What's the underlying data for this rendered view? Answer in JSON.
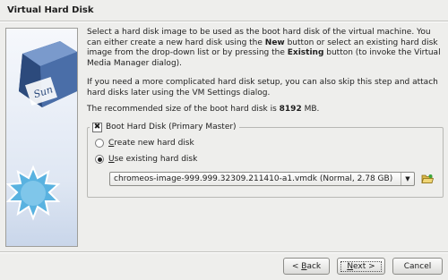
{
  "window": {
    "title": "Virtual Hard Disk"
  },
  "sidebar": {
    "logo_text": "Sun"
  },
  "intro": {
    "p1_a": "Select a hard disk image to be used as the boot hard disk of the virtual machine. You can either create a new hard disk using the ",
    "p1_new": "New",
    "p1_b": " button or select an existing hard disk image from the drop-down list or by pressing the ",
    "p1_existing": "Existing",
    "p1_c": " button (to invoke the Virtual Media Manager dialog).",
    "p2": "If you need a more complicated hard disk setup, you can also skip this step and attach hard disks later using the VM Settings dialog.",
    "p3_a": "The recommended size of the boot hard disk is ",
    "p3_size": "8192",
    "p3_unit": " MB."
  },
  "boot_disk": {
    "checkbox_label": "Boot Hard Disk (Primary Master)",
    "checked": true,
    "create_new_pre": "",
    "create_new_u": "C",
    "create_new_post": "reate new hard disk",
    "use_existing_pre": "",
    "use_existing_u": "U",
    "use_existing_post": "se existing hard disk",
    "selected_option": "use_existing",
    "disk_selected": "chromeos-image-999.999.32309.211410-a1.vmdk (Normal, 2.78 GB)"
  },
  "buttons": {
    "back_arrow": "< ",
    "back_u": "B",
    "back_post": "ack",
    "next_u": "N",
    "next_post": "ext >",
    "cancel": "Cancel"
  },
  "icons": {
    "combo_arrow": "chevron-down-icon",
    "folder": "folder-open-icon"
  }
}
